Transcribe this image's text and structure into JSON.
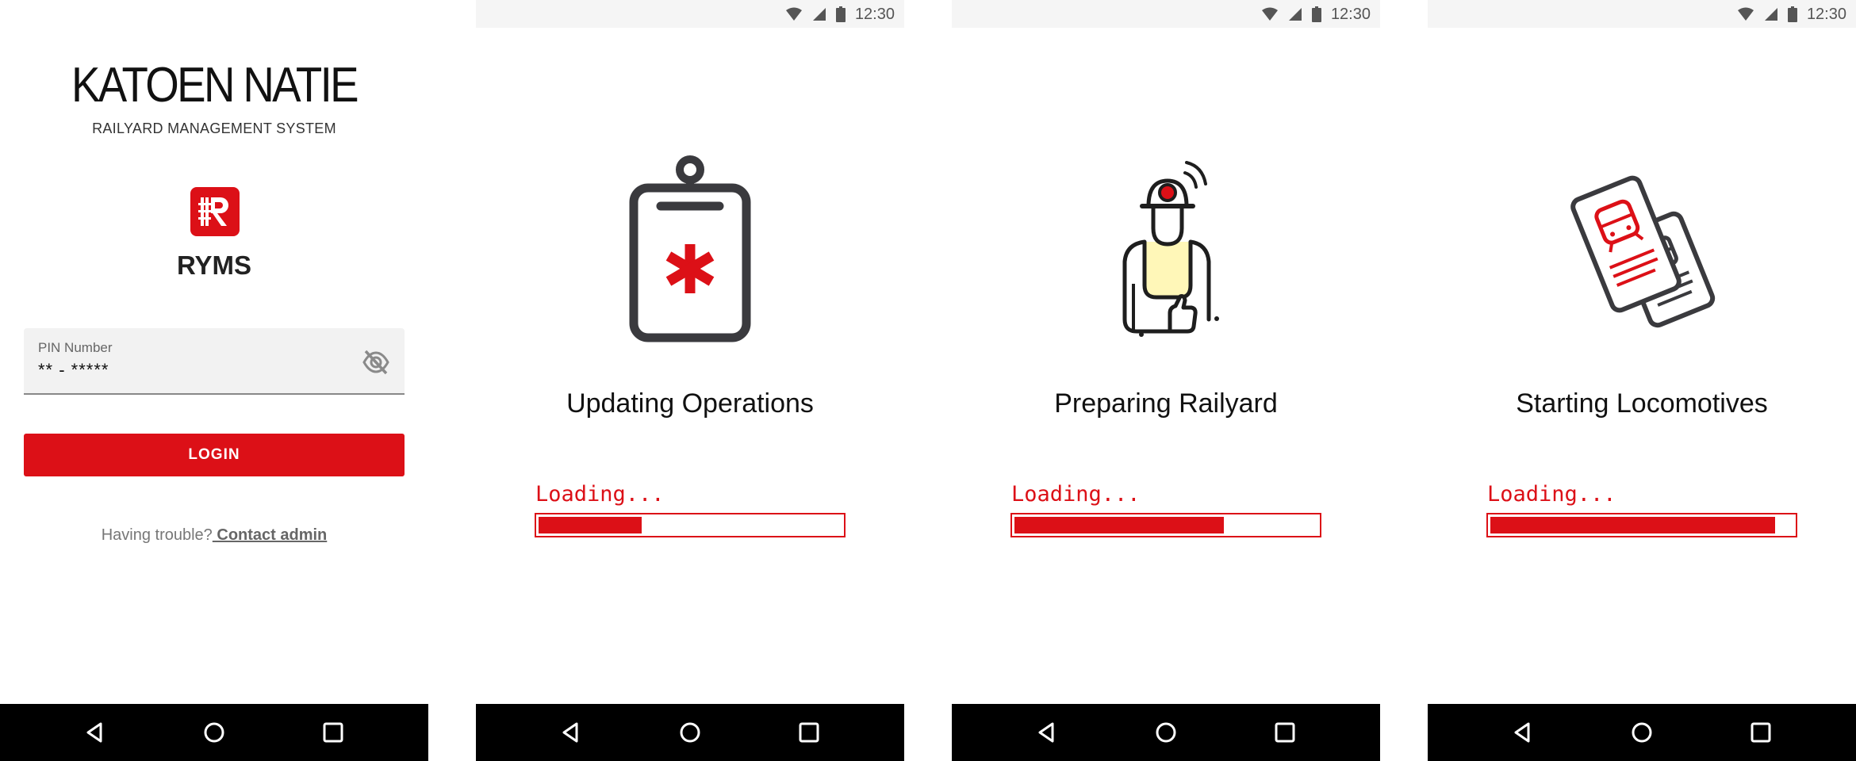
{
  "login": {
    "brand": "KATOEN NATIE",
    "subtitle": "RAILYARD MANAGEMENT SYSTEM",
    "app_icon_letter": "R",
    "app_name": "RYMS",
    "pin_label": "PIN Number",
    "pin_value": "** - *****",
    "login_label": "LOGIN",
    "help_text": "Having trouble?",
    "help_link": " Contact admin"
  },
  "status": {
    "time": "12:30"
  },
  "screens": [
    {
      "title": "Updating Operations",
      "loading": "Loading...",
      "progress": 0.34,
      "icon": "clipboard-asterisk-icon"
    },
    {
      "title": "Preparing Railyard",
      "loading": "Loading...",
      "progress": 0.69,
      "icon": "railway-worker-icon"
    },
    {
      "title": "Starting Locomotives",
      "loading": "Loading...",
      "progress": 0.94,
      "icon": "train-tickets-icon"
    }
  ],
  "colors": {
    "brand_red": "#dc1017",
    "dark": "#3a3a3e",
    "highlight_yellow": "#fff7b8"
  }
}
